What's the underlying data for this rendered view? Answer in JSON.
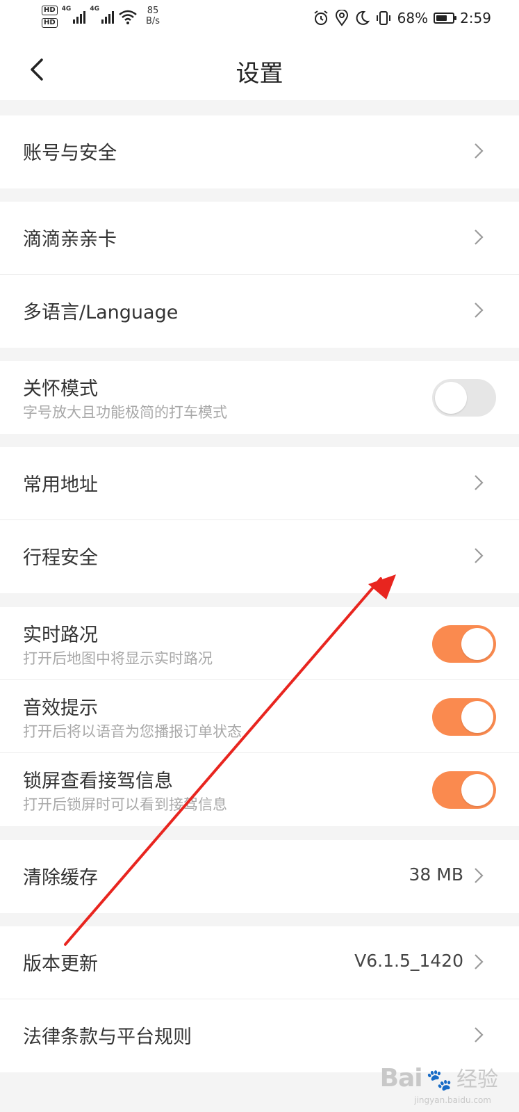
{
  "status_bar": {
    "hd1": "HD",
    "hd2": "HD",
    "net1": "4G",
    "net2": "4G",
    "speed_value": "85",
    "speed_unit": "B/s",
    "battery_percent": "68%",
    "battery_level": 0.68,
    "time": "2:59"
  },
  "header": {
    "title": "设置"
  },
  "sections": {
    "account": {
      "label": "账号与安全"
    },
    "card": {
      "label": "滴滴亲亲卡"
    },
    "language": {
      "label": "多语言/Language"
    },
    "care": {
      "label": "关怀模式",
      "sublabel": "字号放大且功能极简的打车模式",
      "enabled": false
    },
    "address": {
      "label": "常用地址"
    },
    "trip_safety": {
      "label": "行程安全"
    },
    "traffic": {
      "label": "实时路况",
      "sublabel": "打开后地图中将显示实时路况",
      "enabled": true
    },
    "sound": {
      "label": "音效提示",
      "sublabel": "打开后将以语音为您播报订单状态",
      "enabled": true
    },
    "lockscreen": {
      "label": "锁屏查看接驾信息",
      "sublabel": "打开后锁屏时可以看到接驾信息",
      "enabled": true
    },
    "cache": {
      "label": "清除缓存",
      "value": "38 MB"
    },
    "version": {
      "label": "版本更新",
      "value": "V6.1.5_1420"
    },
    "legal": {
      "label": "法律条款与平台规则"
    }
  },
  "watermark": {
    "logo": "Bai",
    "suffix": "经验",
    "url": "jingyan.baidu.com"
  },
  "colors": {
    "accent": "#fa8a4f",
    "annotation_arrow": "#e8251f"
  }
}
